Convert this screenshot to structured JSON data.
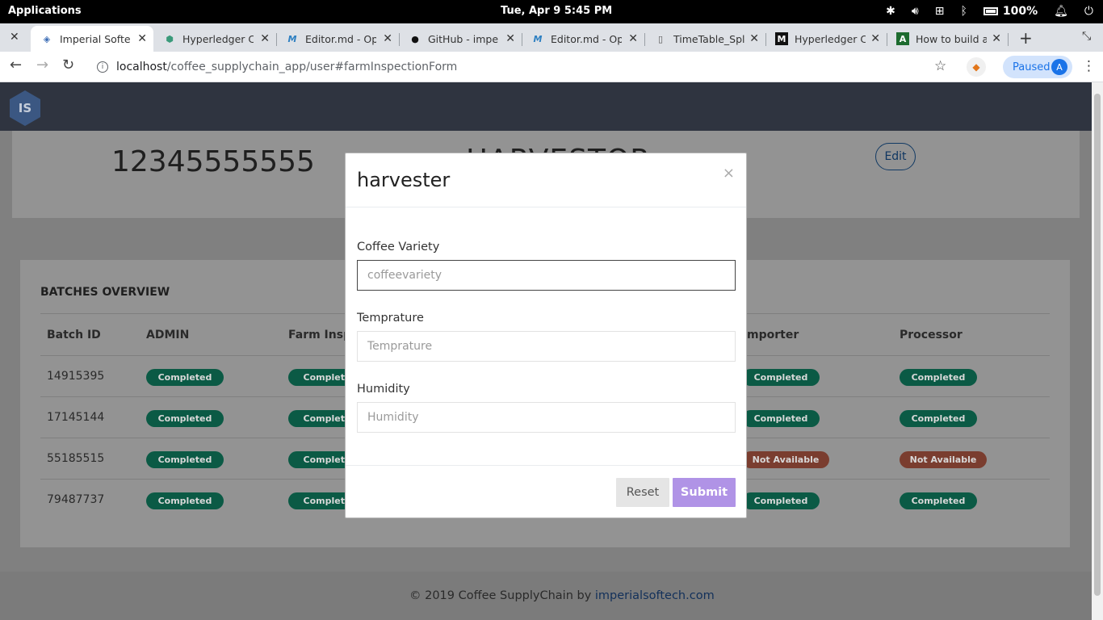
{
  "os": {
    "apps_label": "Applications",
    "clock": "Tue, Apr 9   5:45 PM",
    "battery": "100%"
  },
  "tabs": [
    {
      "title": "Imperial Softech",
      "icon": "imperial-icon"
    },
    {
      "title": "Hyperledger Composer",
      "icon": "hyperledger-icon"
    },
    {
      "title": "Editor.md - Open source",
      "icon": "editor-md-icon"
    },
    {
      "title": "GitHub - imperialsoftech",
      "icon": "github-icon"
    },
    {
      "title": "Editor.md - Open source",
      "icon": "editor-md-icon"
    },
    {
      "title": "TimeTable_Split",
      "icon": "document-icon"
    },
    {
      "title": "Hyperledger Composer",
      "icon": "medium-icon"
    },
    {
      "title": "How to build a blockchain",
      "icon": "green-a-icon"
    }
  ],
  "address": {
    "host": "localhost",
    "path": "/coffee_supplychain_app/user#farmInspectionForm"
  },
  "profile_chip": {
    "label": "Paused",
    "avatar": "A"
  },
  "app": {
    "logo": "IS",
    "user_number": "12345555555",
    "user_role": "HARVESTOR",
    "edit_label": "Edit"
  },
  "batches": {
    "title": "BATCHES OVERVIEW",
    "columns": [
      "Batch ID",
      "ADMIN",
      "Farm Insp",
      "mporter",
      "Processor"
    ],
    "rows": [
      {
        "id": "14915395",
        "admin": "Completed",
        "farm": "Complete",
        "importer": "Completed",
        "processor": "Completed"
      },
      {
        "id": "17145144",
        "admin": "Completed",
        "farm": "Complete",
        "importer": "Completed",
        "processor": "Completed"
      },
      {
        "id": "55185515",
        "admin": "Completed",
        "farm": "Complete",
        "importer": "Not Available",
        "processor": "Not Available"
      },
      {
        "id": "79487737",
        "admin": "Completed",
        "farm": "Complete",
        "importer": "Completed",
        "processor": "Completed"
      }
    ]
  },
  "footer": {
    "text": "© 2019 Coffee SupplyChain by ",
    "link": "imperialsoftech.com"
  },
  "modal": {
    "title": "harvester",
    "close": "×",
    "fields": [
      {
        "label": "Coffee Variety",
        "placeholder": "coffeevariety"
      },
      {
        "label": "Temprature",
        "placeholder": "Temprature"
      },
      {
        "label": "Humidity",
        "placeholder": "Humidity"
      }
    ],
    "reset_label": "Reset",
    "submit_label": "Submit"
  }
}
